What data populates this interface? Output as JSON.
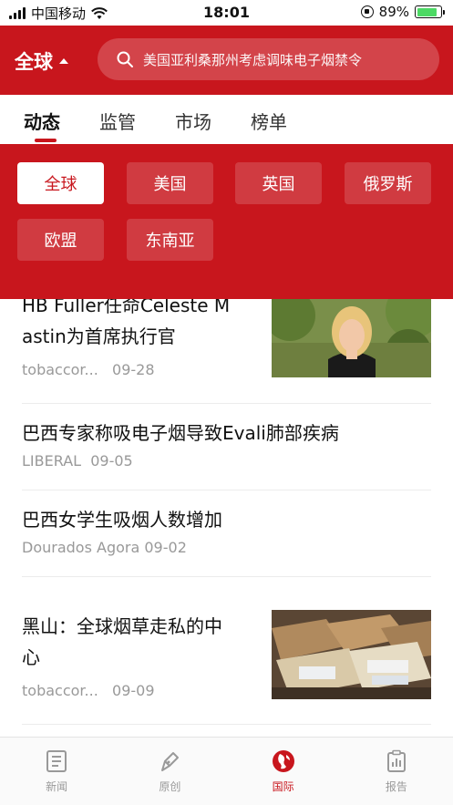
{
  "status_bar": {
    "carrier": "中国移动",
    "time": "18:01",
    "battery": "89%"
  },
  "header": {
    "region_label": "全球",
    "search_placeholder": "美国亚利桑那州考虑调味电子烟禁令"
  },
  "tabs": [
    {
      "label": "动态",
      "active": true
    },
    {
      "label": "监管",
      "active": false
    },
    {
      "label": "市场",
      "active": false
    },
    {
      "label": "榜单",
      "active": false
    }
  ],
  "region_filter": {
    "options": [
      {
        "label": "全球",
        "selected": true
      },
      {
        "label": "美国",
        "selected": false
      },
      {
        "label": "英国",
        "selected": false
      },
      {
        "label": "俄罗斯",
        "selected": false
      },
      {
        "label": "欧盟",
        "selected": false
      },
      {
        "label": "东南亚",
        "selected": false
      }
    ]
  },
  "news": [
    {
      "title_line1": "HB Fuller任命Celeste M",
      "title_line2": "astin为首席执行官",
      "source": "tobaccor...",
      "date": "09-28",
      "has_image": true
    },
    {
      "title_line1": "巴西专家称吸电子烟导致Evali肺部疾病",
      "source": "LIBERAL",
      "date": "09-05",
      "has_image": false
    },
    {
      "title_line1": "巴西女学生吸烟人数增加",
      "source": "Dourados Agora",
      "date": "09-02",
      "has_image": false
    },
    {
      "title_line1": "黑山：全球烟草走私的中",
      "title_line2": "心",
      "source": "tobaccor...",
      "date": "09-09",
      "has_image": true
    }
  ],
  "bottom_nav": [
    {
      "label": "新闻",
      "icon": "news-icon",
      "active": false
    },
    {
      "label": "原创",
      "icon": "pen-icon",
      "active": false
    },
    {
      "label": "国际",
      "icon": "globe-icon",
      "active": true
    },
    {
      "label": "报告",
      "icon": "report-icon",
      "active": false
    }
  ],
  "colors": {
    "brand_red": "#c8161d",
    "muted_text": "#999999"
  }
}
